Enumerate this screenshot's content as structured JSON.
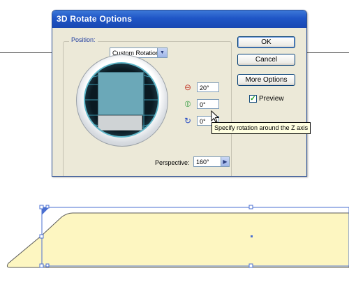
{
  "dialog": {
    "title": "3D Rotate Options",
    "position_label": "Position:",
    "position_value": "Custom Rotation",
    "rotation": {
      "x_value": "20°",
      "y_value": "0°",
      "z_value": "0°"
    },
    "perspective_label": "Perspective:",
    "perspective_value": "160°",
    "buttons": {
      "ok": "OK",
      "cancel": "Cancel",
      "more_options": "More Options"
    },
    "preview_label": "Preview",
    "preview_checked": true,
    "tooltip": "Specify rotation around the Z axis"
  },
  "icons": {
    "x_axis": "x-axis-rotate-icon",
    "y_axis": "y-axis-rotate-icon",
    "z_axis": "z-axis-rotate-icon",
    "dropdown": "chevron-down-icon",
    "perspective_arrow": "arrow-right-icon",
    "cursor": "pointer-cursor-icon"
  },
  "colors": {
    "title_bar": "#1f55c6",
    "shape_fill": "#fdf6c1",
    "selection": "#4a6fd1"
  }
}
